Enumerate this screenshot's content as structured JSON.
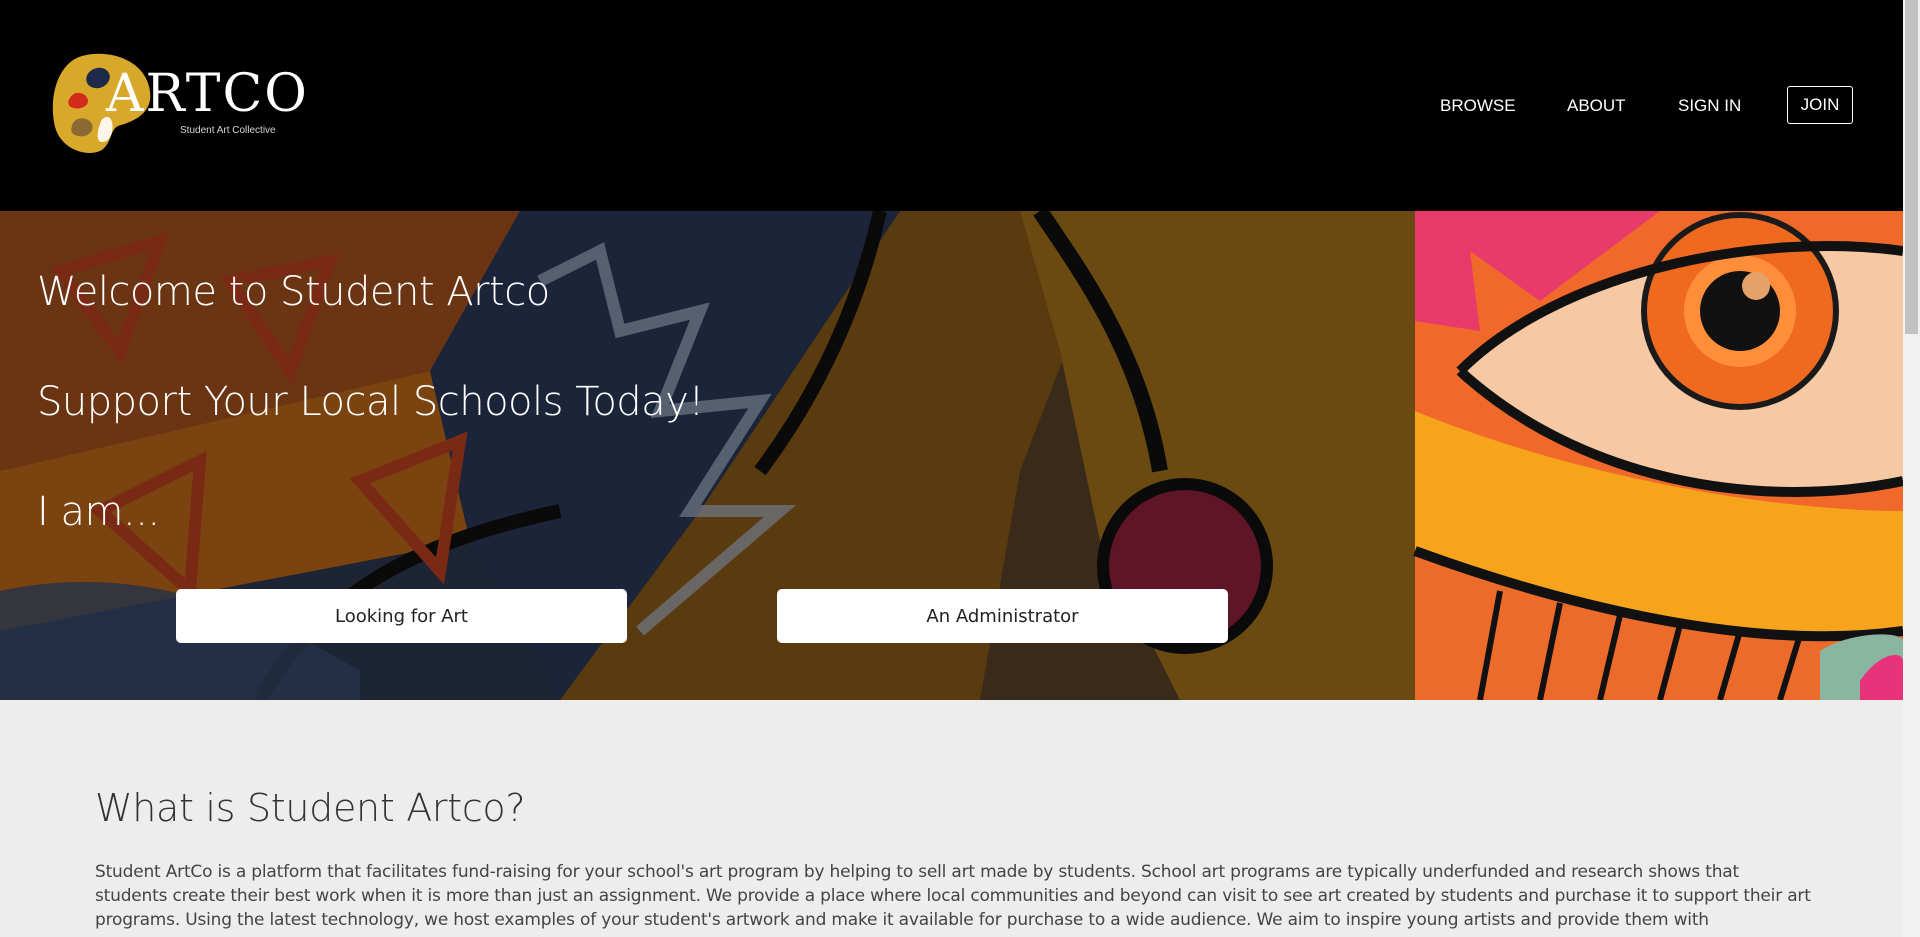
{
  "brand": {
    "name": "ARTCO",
    "tagline": "Student Art Collective"
  },
  "nav": {
    "browse": "BROWSE",
    "about": "ABOUT",
    "sign_in": "SIGN IN",
    "join": "JOIN"
  },
  "hero": {
    "welcome": "Welcome to Student Artco",
    "support": "Support Your Local Schools Today!",
    "i_am": "I am...",
    "buttons": {
      "art_seeker": "Looking for Art",
      "administrator": "An Administrator"
    }
  },
  "about": {
    "heading": "What is Student Artco?",
    "body": "Student ArtCo is a platform that facilitates fund-raising for your school's art program by helping to sell art made by students. School art programs are typically underfunded and research shows that students create their best work when it is more than just an assignment. We provide a place where local communities and beyond can visit to see art created by students and purchase it to support their art programs. Using the latest technology, we host examples of your student's artwork and make it available for purchase to a wide audience. We aim to inspire young artists and provide them with"
  },
  "colors": {
    "header_bg": "#000000",
    "section_bg": "#ededed",
    "logo_gold": "#d8a82a"
  }
}
